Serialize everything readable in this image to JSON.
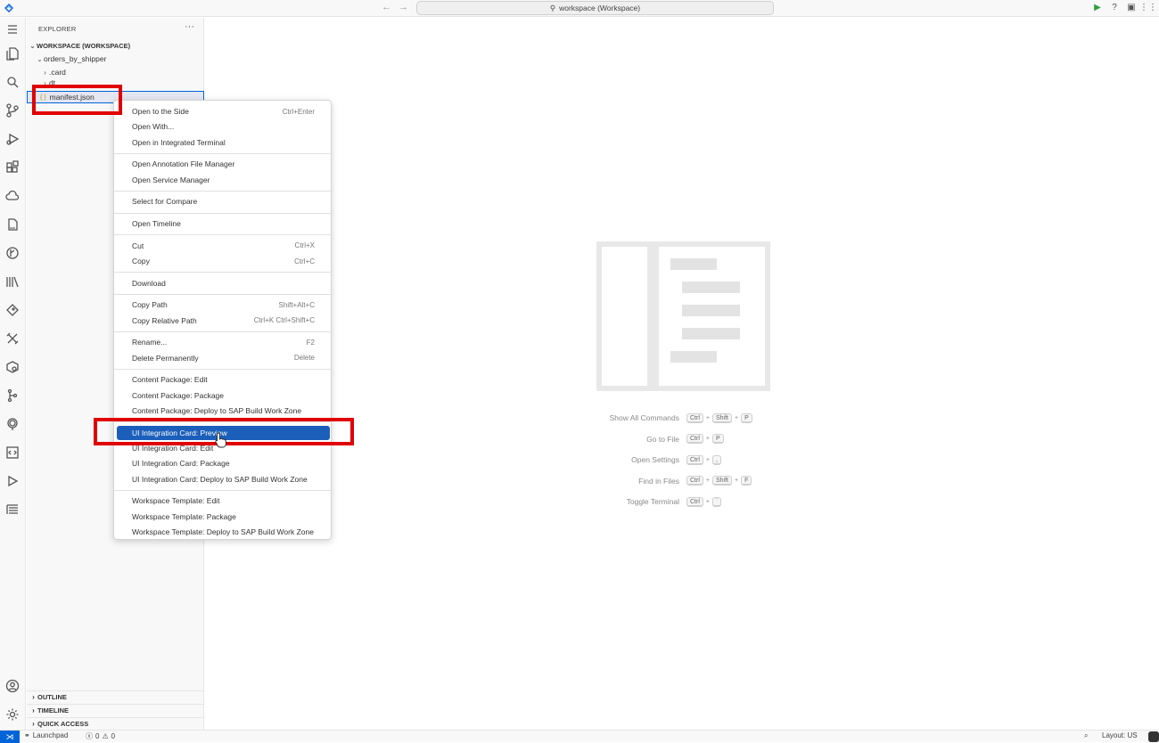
{
  "titlebar": {
    "search_text": "workspace (Workspace)",
    "back_icon": "arrow-left-icon",
    "forward_icon": "arrow-right-icon"
  },
  "activity_bar": {
    "icons": [
      "menu-icon",
      "explorer-icon",
      "search-icon",
      "source-control-icon",
      "run-debug-icon",
      "extensions-icon",
      "cloud-icon",
      "log-icon",
      "git-graph-icon",
      "library-icon",
      "gem-icon",
      "tools-icon",
      "settings-cube-icon",
      "branch-icon",
      "location-icon",
      "code-icon",
      "play-icon",
      "list-icon",
      "account-icon",
      "gear-icon"
    ]
  },
  "sidebar": {
    "header": "EXPLORER",
    "workspace_label": "WORKSPACE (WORKSPACE)",
    "folder": "orders_by_shipper",
    "subfolder_card": ".card",
    "subfolder_dt": "dt",
    "file_selected": "manifest.json",
    "sections": [
      "OUTLINE",
      "TIMELINE",
      "QUICK ACCESS"
    ]
  },
  "context_menu": {
    "groups": [
      [
        {
          "label": "Open to the Side",
          "kb": "Ctrl+Enter"
        },
        {
          "label": "Open With...",
          "kb": ""
        },
        {
          "label": "Open in Integrated Terminal",
          "kb": ""
        }
      ],
      [
        {
          "label": "Open Annotation File Manager",
          "kb": ""
        },
        {
          "label": "Open Service Manager",
          "kb": ""
        }
      ],
      [
        {
          "label": "Select for Compare",
          "kb": ""
        }
      ],
      [
        {
          "label": "Open Timeline",
          "kb": ""
        }
      ],
      [
        {
          "label": "Cut",
          "kb": "Ctrl+X"
        },
        {
          "label": "Copy",
          "kb": "Ctrl+C"
        }
      ],
      [
        {
          "label": "Download",
          "kb": ""
        }
      ],
      [
        {
          "label": "Copy Path",
          "kb": "Shift+Alt+C"
        },
        {
          "label": "Copy Relative Path",
          "kb": "Ctrl+K Ctrl+Shift+C"
        }
      ],
      [
        {
          "label": "Rename...",
          "kb": "F2"
        },
        {
          "label": "Delete Permanently",
          "kb": "Delete"
        }
      ],
      [
        {
          "label": "Content Package: Edit",
          "kb": ""
        },
        {
          "label": "Content Package: Package",
          "kb": ""
        },
        {
          "label": "Content Package: Deploy to SAP Build Work Zone",
          "kb": ""
        }
      ],
      [
        {
          "label": "UI Integration Card: Preview",
          "kb": ""
        },
        {
          "label": "UI Integration Card: Edit",
          "kb": ""
        },
        {
          "label": "UI Integration Card: Package",
          "kb": ""
        },
        {
          "label": "UI Integration Card: Deploy to SAP Build Work Zone",
          "kb": ""
        }
      ],
      [
        {
          "label": "Workspace Template: Edit",
          "kb": ""
        },
        {
          "label": "Workspace Template: Package",
          "kb": ""
        },
        {
          "label": "Workspace Template: Deploy to SAP Build Work Zone",
          "kb": ""
        }
      ]
    ],
    "highlighted": "UI Integration Card: Preview"
  },
  "editor": {
    "shortcuts": [
      {
        "label": "Show All Commands",
        "keys": [
          "Ctrl",
          "+",
          "Shift",
          "+",
          "P"
        ]
      },
      {
        "label": "Go to File",
        "keys": [
          "Ctrl",
          "+",
          "P"
        ]
      },
      {
        "label": "Open Settings",
        "keys": [
          "Ctrl",
          "+",
          ","
        ]
      },
      {
        "label": "Find in Files",
        "keys": [
          "Ctrl",
          "+",
          "Shift",
          "+",
          "F"
        ]
      },
      {
        "label": "Toggle Terminal",
        "keys": [
          "Ctrl",
          "+",
          "`"
        ]
      }
    ]
  },
  "statusbar": {
    "launchpad": "Launchpad",
    "errors": "0",
    "warnings": "0",
    "layout": "Layout: US"
  },
  "colors": {
    "accent": "#0064d9",
    "highlight": "#1b5fba",
    "annotation_red": "#e00000"
  }
}
